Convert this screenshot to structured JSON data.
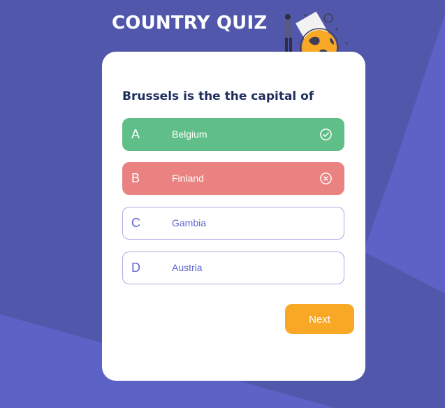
{
  "app": {
    "title": "COUNTRY QUIZ"
  },
  "quiz": {
    "question": "Brussels is the the capital of",
    "options": [
      {
        "letter": "A",
        "text": "Belgium",
        "state": "correct",
        "icon": "check-circle-icon"
      },
      {
        "letter": "B",
        "text": "Finland",
        "state": "wrong",
        "icon": "x-circle-icon"
      },
      {
        "letter": "C",
        "text": "Gambia",
        "state": "neutral"
      },
      {
        "letter": "D",
        "text": "Austria",
        "state": "neutral"
      }
    ],
    "next_label": "Next"
  },
  "colors": {
    "background": "#5d63c6",
    "correct": "#60bf88",
    "wrong": "#ea8282",
    "accent": "#f9a826",
    "question_text": "#1d2d5e",
    "option_text": "#6066d0"
  }
}
